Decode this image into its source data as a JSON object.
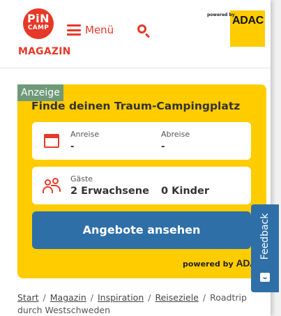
{
  "header": {
    "logo_line1": "PiN",
    "logo_line2": "CAMP",
    "logo_sub": "MAGAZIN",
    "menu_label": "Menü",
    "search_icon": "search-icon",
    "adac_powered": "powered by",
    "adac_word": "ADAC"
  },
  "ad": {
    "label": "Anzeige",
    "title": "Finde deinen Traum-Campingplatz",
    "arrival_label": "Anreise",
    "arrival_value": "-",
    "departure_label": "Abreise",
    "departure_value": "-",
    "guests_label": "Gäste",
    "adults": "2 Erwachsene",
    "children": "0 Kinder",
    "cta": "Angebote ansehen",
    "powered_by": "powered by",
    "powered_brand": "ADAC"
  },
  "breadcrumb": {
    "items": [
      "Start",
      "Magazin",
      "Inspiration",
      "Reiseziele"
    ],
    "current": "Roadtrip durch Westschweden",
    "separator": "/"
  },
  "feedback": {
    "label": "Feedback"
  },
  "colors": {
    "brand_red": "#e63928",
    "adac_yellow": "#ffcc00",
    "button_blue": "#2f6fa8"
  }
}
